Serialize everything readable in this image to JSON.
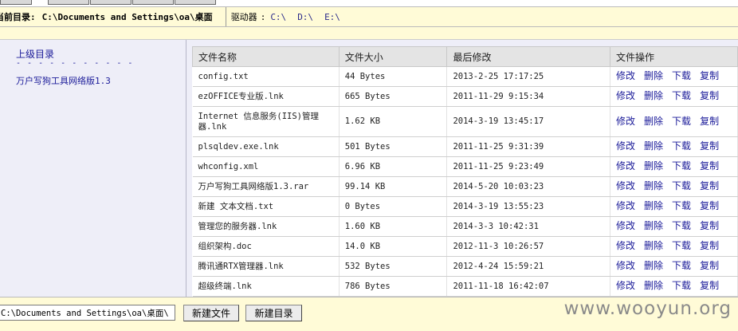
{
  "header": {
    "current_dir_label": "当前目录:",
    "current_dir_path": "C:\\Documents and Settings\\oa\\桌面",
    "drives_label": "驱动器",
    "drives_colon": ":",
    "drives": [
      "C:\\",
      "D:\\",
      "E:\\"
    ]
  },
  "sidebar": {
    "parent_link": "上级目录",
    "dashes": "- - - - - - - - - - -",
    "folders": [
      "万户写狗工具网络版1.3"
    ]
  },
  "table": {
    "columns": [
      "文件名称",
      "文件大小",
      "最后修改",
      "文件操作"
    ],
    "actions": [
      "修改",
      "删除",
      "下载",
      "复制"
    ],
    "rows": [
      {
        "name": "config.txt",
        "size": "44 Bytes",
        "modified": "2013-2-25 17:17:25"
      },
      {
        "name": "ezOFFICE专业版.lnk",
        "size": "665 Bytes",
        "modified": "2011-11-29 9:15:34"
      },
      {
        "name": "Internet 信息服务(IIS)管理器.lnk",
        "size": "1.62 KB",
        "modified": "2014-3-19 13:45:17"
      },
      {
        "name": "plsqldev.exe.lnk",
        "size": "501 Bytes",
        "modified": "2011-11-25 9:31:39"
      },
      {
        "name": "whconfig.xml",
        "size": "6.96 KB",
        "modified": "2011-11-25 9:23:49"
      },
      {
        "name": "万户写狗工具网络版1.3.rar",
        "size": "99.14 KB",
        "modified": "2014-5-20 10:03:23"
      },
      {
        "name": "新建 文本文档.txt",
        "size": "0 Bytes",
        "modified": "2014-3-19 13:55:23"
      },
      {
        "name": "管理您的服务器.lnk",
        "size": "1.60 KB",
        "modified": "2014-3-3 10:42:31"
      },
      {
        "name": "组织架构.doc",
        "size": "14.0 KB",
        "modified": "2012-11-3 10:26:57"
      },
      {
        "name": "腾讯通RTX管理器.lnk",
        "size": "532 Bytes",
        "modified": "2012-4-24 15:59:21"
      },
      {
        "name": "超级终端.lnk",
        "size": "786 Bytes",
        "modified": "2011-11-18 16:42:07"
      }
    ]
  },
  "footer": {
    "path_value": "C:\\Documents and Settings\\oa\\桌面\\",
    "new_file_button": "新建文件",
    "new_dir_button": "新建目录",
    "watermark": "www.wooyun.org"
  }
}
